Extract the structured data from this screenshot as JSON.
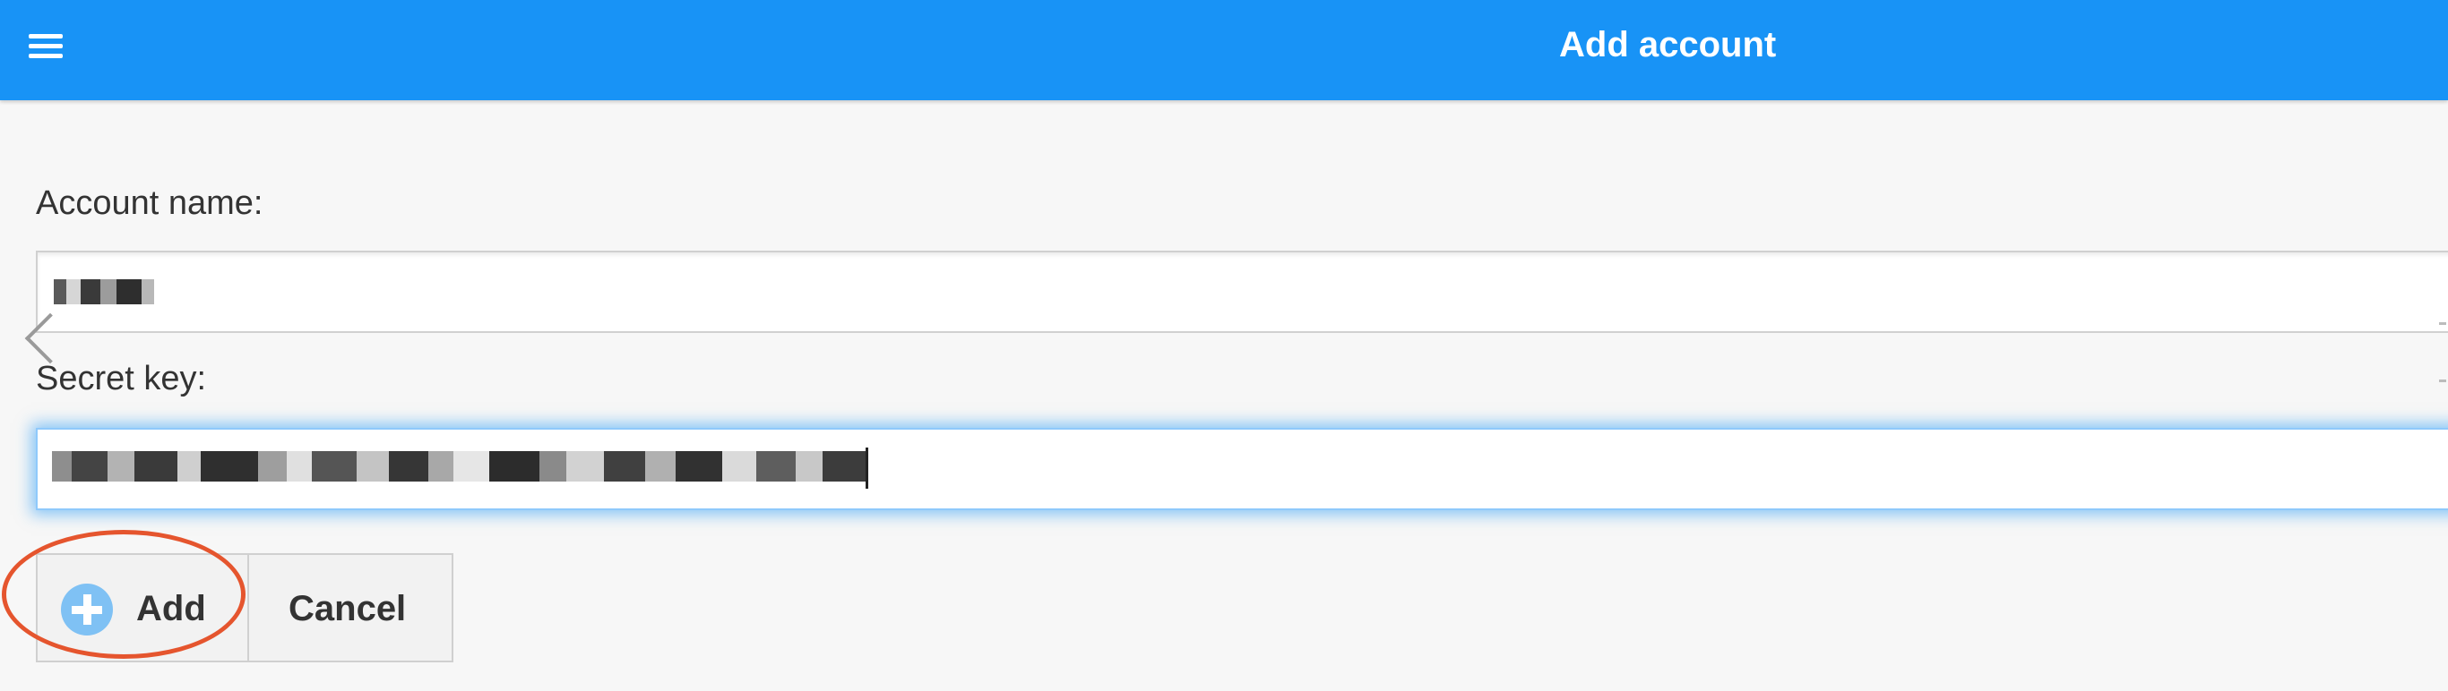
{
  "header": {
    "title": "Add account",
    "menu_icon": "hamburger-menu-icon",
    "background": "#1893f6"
  },
  "form": {
    "account_name": {
      "label": "Account name:",
      "value": ""
    },
    "secret_key": {
      "label": "Secret key:",
      "value": "",
      "focused": true
    }
  },
  "buttons": {
    "add": {
      "label": "Add",
      "icon": "plus-circle-icon"
    },
    "cancel": {
      "label": "Cancel"
    }
  },
  "annotation": {
    "highlight_color": "#e5552e"
  },
  "colors": {
    "accent": "#1893f6",
    "focus_glow": "#8fc9fb",
    "background": "#f7f7f7"
  }
}
